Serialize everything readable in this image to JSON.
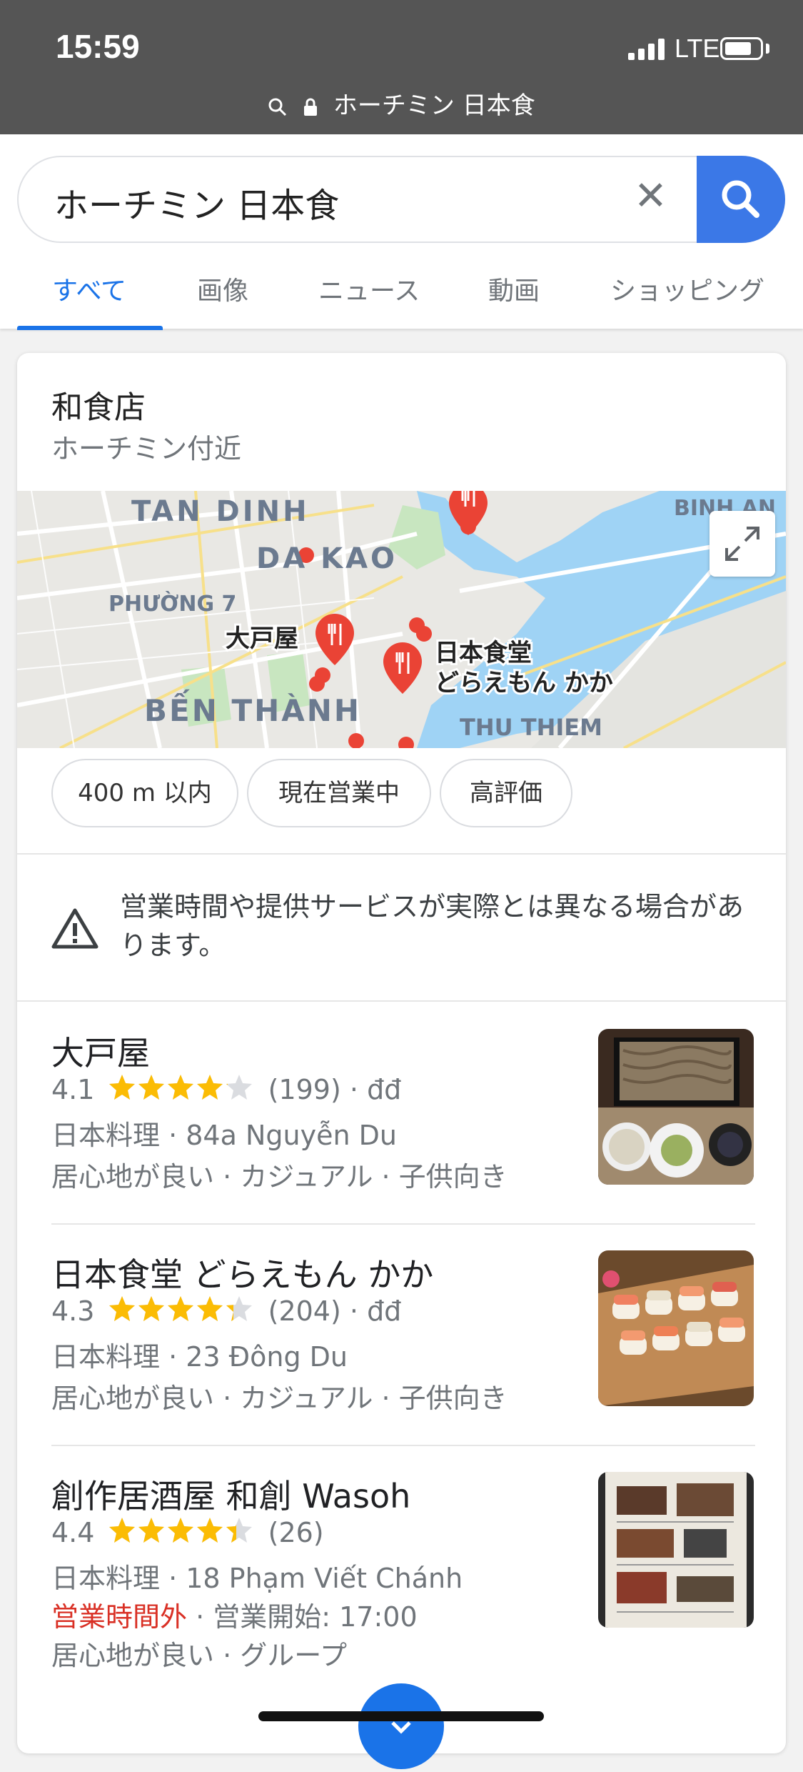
{
  "status_bar": {
    "time": "15:59",
    "network": "LTE"
  },
  "url_bar": {
    "text": "ホーチミン 日本食"
  },
  "search": {
    "query": "ホーチミン 日本食"
  },
  "tabs": [
    {
      "label": "すべて",
      "active": true
    },
    {
      "label": "画像"
    },
    {
      "label": "ニュース"
    },
    {
      "label": "動画"
    },
    {
      "label": "ショッピング"
    }
  ],
  "local_pack": {
    "title": "和食店",
    "subtitle": "ホーチミン付近",
    "map": {
      "labels": {
        "tan_dinh": "TAN DINH",
        "da_kao": "DA KAO",
        "phuong7": "PHƯỜNG 7",
        "ben_thanh": "BẾN THÀNH",
        "thu_thiem": "THU THIEM",
        "binh_an": "BINH AN",
        "pin_ootoya": "大戸屋",
        "pin_doraemon_1": "日本食堂",
        "pin_doraemon_2": "どらえもん かか"
      }
    },
    "chips": [
      "400 m 以内",
      "現在営業中",
      "高評価"
    ],
    "warning": "営業時間や提供サービスが実際とは異なる場合があります。",
    "listings": [
      {
        "name": "大戸屋",
        "rating": "4.1",
        "rating_value": 4.1,
        "reviews": "(199)",
        "price": "· đđ",
        "category_address": "日本料理 · 84a Nguyễn Du",
        "attributes": "居心地が良い · カジュアル · 子供向き"
      },
      {
        "name": "日本食堂 どらえもん かか",
        "rating": "4.3",
        "rating_value": 4.3,
        "reviews": "(204)",
        "price": "· đđ",
        "category_address": "日本料理 · 23 Đông Du",
        "attributes": "居心地が良い · カジュアル · 子供向き"
      },
      {
        "name": "創作居酒屋 和創 Wasoh",
        "rating": "4.4",
        "rating_value": 4.4,
        "reviews": "(26)",
        "category_address": "日本料理 · 18 Phạm Viết Chánh",
        "status_closed": "営業時間外",
        "status_open_time": " · 営業開始: 17:00",
        "attributes": "居心地が良い · グループ"
      }
    ]
  },
  "colors": {
    "accent": "#1a73e8",
    "search_button": "#3b78e7",
    "star": "#fbbc04",
    "closed": "#d93025",
    "status_bar": "#555555"
  }
}
